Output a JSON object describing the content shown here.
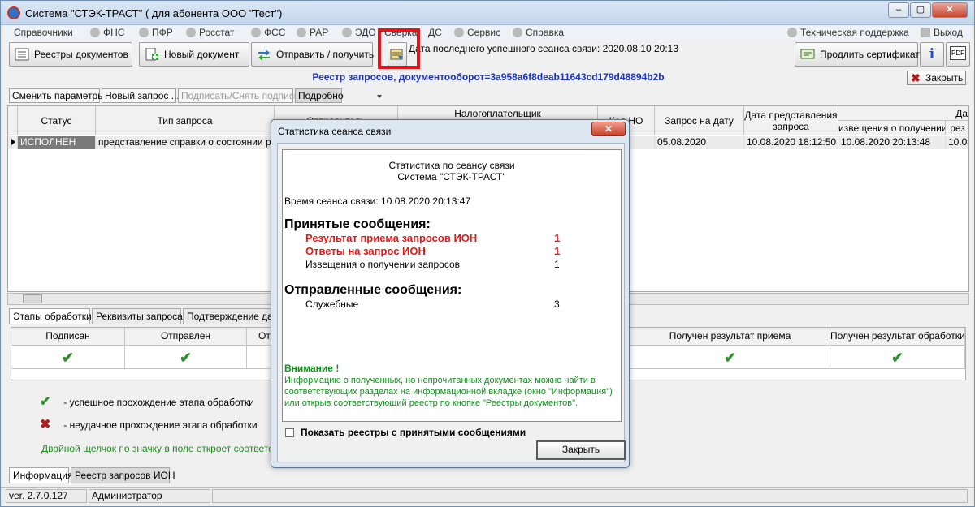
{
  "window": {
    "title": "Система \"СТЭК-ТРАСТ\" ( для абонента ООО \"Тест\")",
    "minimize": "–",
    "maximize": "▢",
    "close": "✕"
  },
  "menu": {
    "items": [
      "Справочники",
      "ФНС",
      "ПФР",
      "Росстат",
      "ФСС",
      "РАР",
      "ЭДО",
      "Сверка",
      "ДС",
      "Сервис",
      "Справка"
    ],
    "support": "Техническая поддержка",
    "exit": "Выход"
  },
  "toolbar": {
    "registries": "Реестры документов",
    "new_document": "Новый документ",
    "send_receive": "Отправить / получить",
    "last_session": "Дата последнего успешного сеанса связи: 2020.08.10 20:13",
    "renew_certificate": "Продлить сертификат",
    "info_glyph": "i",
    "pdf_glyph": "PDF"
  },
  "registry": {
    "title": "Реестр запросов, документооборот=3a958a6f8deab11643cd179d48894b2b",
    "close_label": "Закрыть",
    "actions": {
      "change_params": "Сменить параметры",
      "new_request": "Новый запрос ...",
      "sign": "Подписать/Снять подпись",
      "details": "Подробно"
    },
    "columns": {
      "status": "Статус",
      "request_type": "Тип запроса",
      "sender": "Отправитель",
      "taxpayer": "Налогоплательщик",
      "ifns_code": "Код НО",
      "request_date": "Запрос на дату",
      "submission_date_1": "Дата представления",
      "submission_date_2": "запроса",
      "date_group": "Да",
      "receipt_notice": "извещения о получении",
      "result_short": "рез"
    },
    "row": {
      "status": "ИСПОЛНЕН",
      "request_type": "представление справки о состоянии рас...",
      "request_date": "05.08.2020",
      "submitted": "10.08.2020 18:12:50",
      "receipt_notice": "10.08.2020 20:13:48",
      "result_short": "10.08"
    }
  },
  "detail_tabs": [
    "Этапы обработки",
    "Реквизиты запроса",
    "Подтверждение даты"
  ],
  "stages": {
    "columns": [
      "Подписан",
      "Отправлен",
      "Отп",
      "Получен результат приема",
      "Получен результат обработки"
    ],
    "check_glyph": "✔"
  },
  "legend": {
    "success": "- успешное прохождение этапа обработки",
    "fail": "- неудачное прохождение этапа обработки",
    "success_glyph": "✔",
    "fail_glyph": "✖",
    "hint": "Двойной щелчок по значку в поле откроет соответствующий документ"
  },
  "bottom_tabs": [
    "Информация",
    "Реестр запросов ИОН"
  ],
  "status_bar": {
    "version": "ver. 2.7.0.127",
    "user": "Администратор"
  },
  "dialog": {
    "title": "Статистика сеанса связи",
    "close_glyph": "✕",
    "report": {
      "heading1": "Статистика по сеансу связи",
      "heading2": "Система \"СТЭК-ТРАСТ\"",
      "session_time": "Время сеанса связи: 10.08.2020 20:13:47",
      "received_title": "Принятые сообщения:",
      "received": [
        {
          "label": "Результат приема запросов ИОН",
          "count": "1",
          "highlight": true
        },
        {
          "label": "Ответы на запрос ИОН",
          "count": "1",
          "highlight": true
        },
        {
          "label": "Извещения о получении запросов",
          "count": "1",
          "highlight": false
        }
      ],
      "sent_title": "Отправленные сообщения:",
      "sent": [
        {
          "label": "Служебные",
          "count": "3"
        }
      ],
      "warning_title": "Внимание !",
      "warning_line1": "Информацию о полученных, но непрочитанных документах можно найти в",
      "warning_line2": "соответствующих разделах на информационной вкладке (окно \"Информация\")",
      "warning_line3": "или открыв соответствующий реестр по кнопке \"Реестры документов\"."
    },
    "show_registries": "Показать реестры с принятыми сообщениями",
    "close_button": "Закрыть"
  },
  "colors": {
    "accent_blue": "#1a33c9",
    "highlight_red": "#e4141b",
    "success_green": "#2f8f2f",
    "fail_red": "#b51c1c"
  }
}
